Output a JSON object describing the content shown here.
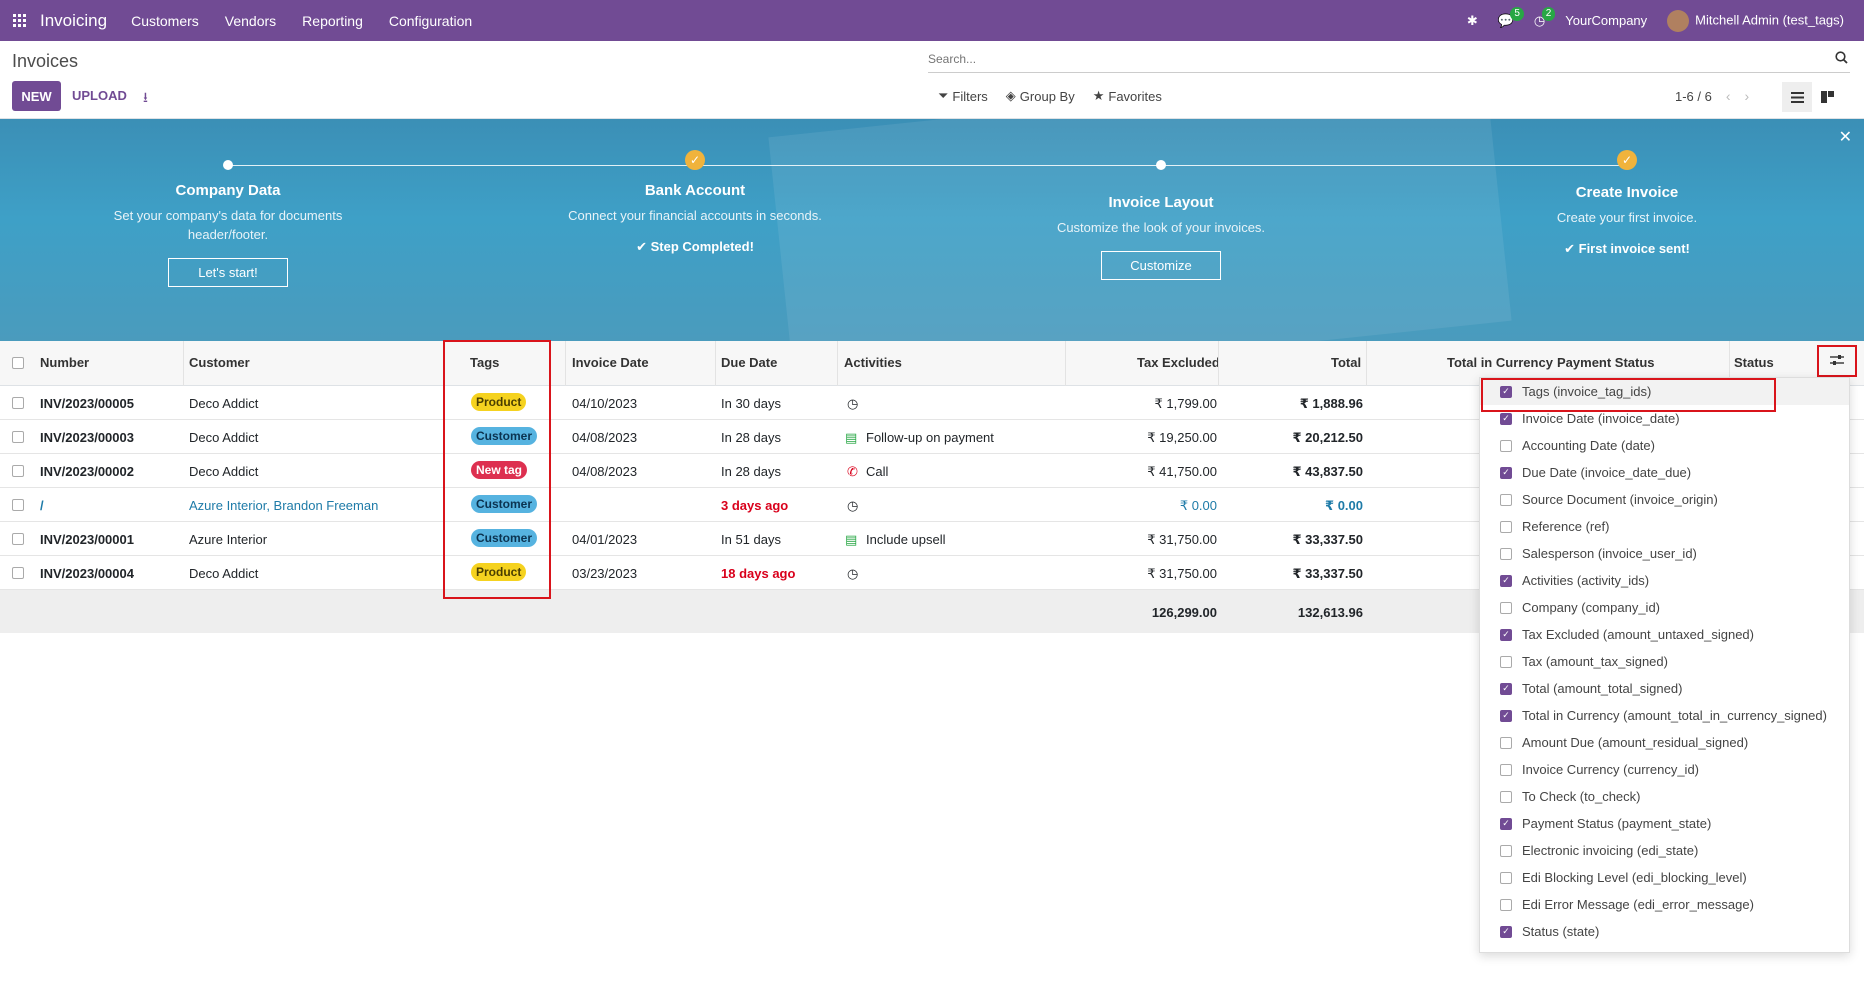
{
  "navbar": {
    "app_name": "Invoicing",
    "menu": [
      "Customers",
      "Vendors",
      "Reporting",
      "Configuration"
    ],
    "messages_count": "5",
    "activities_count": "2",
    "company": "YourCompany",
    "user": "Mitchell Admin (test_tags)"
  },
  "control_panel": {
    "title": "Invoices",
    "new_label": "NEW",
    "upload_label": "UPLOAD",
    "search_placeholder": "Search...",
    "filters_label": "Filters",
    "groupby_label": "Group By",
    "favorites_label": "Favorites",
    "pager": "1-6 / 6"
  },
  "banner": {
    "steps": [
      {
        "title": "Company Data",
        "desc": "Set your company's data for documents header/footer.",
        "button": "Let's start!"
      },
      {
        "title": "Bank Account",
        "desc": "Connect your financial accounts in seconds.",
        "done": "Step Completed!"
      },
      {
        "title": "Invoice Layout",
        "desc": "Customize the look of your invoices.",
        "button": "Customize"
      },
      {
        "title": "Create Invoice",
        "desc": "Create your first invoice.",
        "done": "First invoice sent!"
      }
    ]
  },
  "table": {
    "headers": {
      "number": "Number",
      "customer": "Customer",
      "tags": "Tags",
      "invoice_date": "Invoice Date",
      "due_date": "Due Date",
      "activities": "Activities",
      "tax_excluded": "Tax Excluded",
      "total": "Total",
      "total_currency": "Total in Currency",
      "payment_status": "Payment Status",
      "status": "Status"
    },
    "rows": [
      {
        "number": "INV/2023/00005",
        "customer": "Deco Addict",
        "tag": "Product",
        "invoice_date": "04/10/2023",
        "due_date": "In 30 days",
        "activity": "",
        "tax_excluded": "₹ 1,799.00",
        "total": "₹ 1,888.96"
      },
      {
        "number": "INV/2023/00003",
        "customer": "Deco Addict",
        "tag": "Customer",
        "invoice_date": "04/08/2023",
        "due_date": "In 28 days",
        "activity": "Follow-up on payment",
        "tax_excluded": "₹ 19,250.00",
        "total": "₹ 20,212.50"
      },
      {
        "number": "INV/2023/00002",
        "customer": "Deco Addict",
        "tag": "New tag",
        "invoice_date": "04/08/2023",
        "due_date": "In 28 days",
        "activity": "Call",
        "tax_excluded": "₹ 41,750.00",
        "total": "₹ 43,837.50"
      },
      {
        "number": "/",
        "customer": "Azure Interior, Brandon Freeman",
        "tag": "Customer",
        "invoice_date": "",
        "due_date": "3 days ago",
        "activity": "",
        "tax_excluded": "₹ 0.00",
        "total": "₹ 0.00"
      },
      {
        "number": "INV/2023/00001",
        "customer": "Azure Interior",
        "tag": "Customer",
        "invoice_date": "04/01/2023",
        "due_date": "In 51 days",
        "activity": "Include upsell",
        "tax_excluded": "₹ 31,750.00",
        "total": "₹ 33,337.50"
      },
      {
        "number": "INV/2023/00004",
        "customer": "Deco Addict",
        "tag": "Product",
        "invoice_date": "03/23/2023",
        "due_date": "18 days ago",
        "activity": "",
        "tax_excluded": "₹ 31,750.00",
        "total": "₹ 33,337.50"
      }
    ],
    "totals": {
      "tax_excluded": "126,299.00",
      "total": "132,613.96"
    }
  },
  "columns_menu": [
    {
      "label": "Tags (invoice_tag_ids)",
      "checked": true
    },
    {
      "label": "Invoice Date (invoice_date)",
      "checked": true
    },
    {
      "label": "Accounting Date (date)",
      "checked": false
    },
    {
      "label": "Due Date (invoice_date_due)",
      "checked": true
    },
    {
      "label": "Source Document (invoice_origin)",
      "checked": false
    },
    {
      "label": "Reference (ref)",
      "checked": false
    },
    {
      "label": "Salesperson (invoice_user_id)",
      "checked": false
    },
    {
      "label": "Activities (activity_ids)",
      "checked": true
    },
    {
      "label": "Company (company_id)",
      "checked": false
    },
    {
      "label": "Tax Excluded (amount_untaxed_signed)",
      "checked": true
    },
    {
      "label": "Tax (amount_tax_signed)",
      "checked": false
    },
    {
      "label": "Total (amount_total_signed)",
      "checked": true
    },
    {
      "label": "Total in Currency (amount_total_in_currency_signed)",
      "checked": true
    },
    {
      "label": "Amount Due (amount_residual_signed)",
      "checked": false
    },
    {
      "label": "Invoice Currency (currency_id)",
      "checked": false
    },
    {
      "label": "To Check (to_check)",
      "checked": false
    },
    {
      "label": "Payment Status (payment_state)",
      "checked": true
    },
    {
      "label": "Electronic invoicing (edi_state)",
      "checked": false
    },
    {
      "label": "Edi Blocking Level (edi_blocking_level)",
      "checked": false
    },
    {
      "label": "Edi Error Message (edi_error_message)",
      "checked": false
    },
    {
      "label": "Status (state)",
      "checked": true
    }
  ],
  "colors": {
    "brand": "#714b94",
    "danger": "#d9001b",
    "banner": "#3ea0c7"
  }
}
